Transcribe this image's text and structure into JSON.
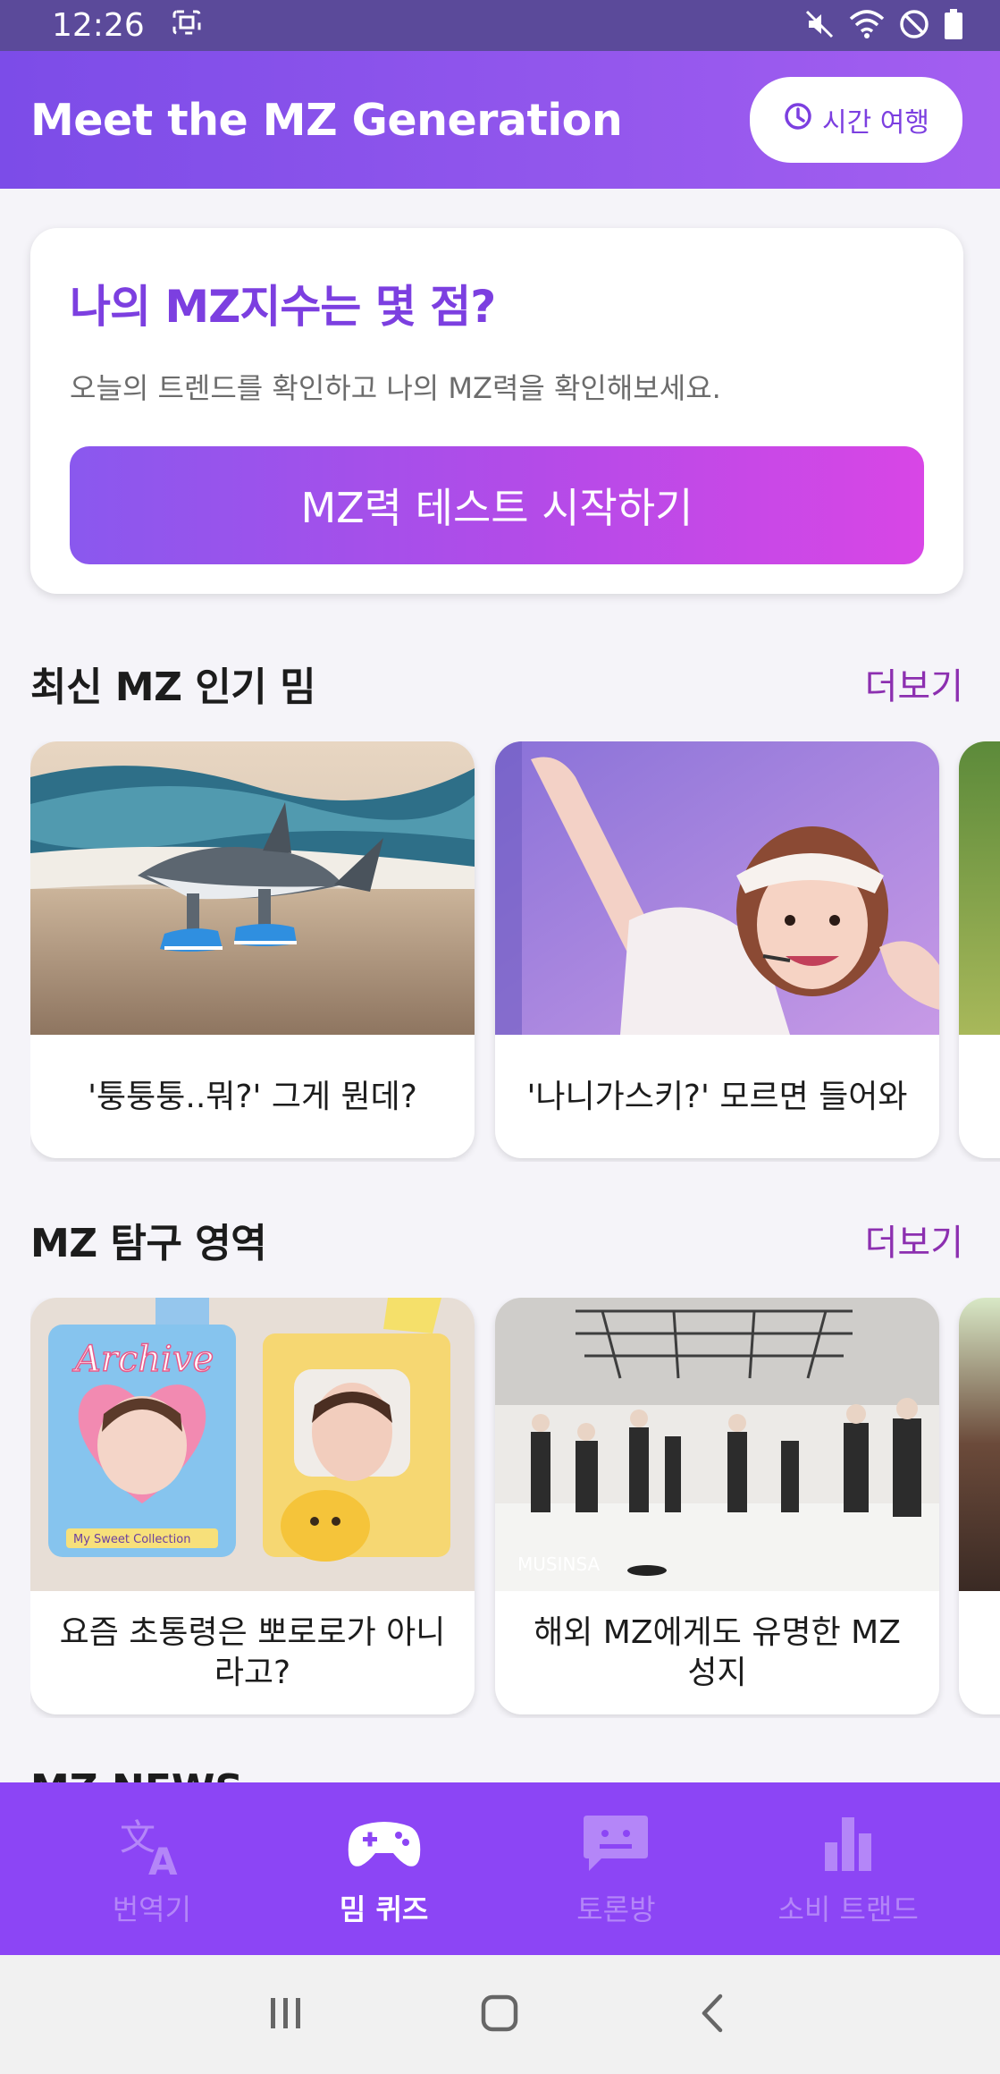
{
  "status_bar": {
    "time": "12:26"
  },
  "app_bar": {
    "title": "Meet the MZ Generation",
    "time_travel_label": "시간 여행"
  },
  "hero": {
    "title": "나의 MZ지수는 몇 점?",
    "subtitle": "오늘의 트렌드를 확인하고 나의 MZ력을 확인해보세요.",
    "button_label": "MZ력 테스트 시작하기"
  },
  "memes": {
    "title": "최신 MZ 인기 밈",
    "more_label": "더보기",
    "cards": [
      {
        "caption": "'퉁퉁퉁..뭐?' 그게 뭔데?"
      },
      {
        "caption": "'나니가스키?' 모르면 들어와"
      }
    ]
  },
  "explore": {
    "title": "MZ 탐구 영역",
    "more_label": "더보기",
    "cards": [
      {
        "caption": "요즘 초통령은 뽀로로가 아니라고?",
        "logo_text": "Archive",
        "tag_text": "My Sweet Collection"
      },
      {
        "caption": "해외 MZ에게도 유명한 MZ 성지",
        "watermark": "MUSINSA"
      }
    ]
  },
  "news_peek": {
    "title": "MZ NEWS"
  },
  "bottom_nav": {
    "items": [
      {
        "label": "번역기",
        "icon": "translate-icon",
        "active": false
      },
      {
        "label": "밈 퀴즈",
        "icon": "gamepad-icon",
        "active": true
      },
      {
        "label": "토론방",
        "icon": "chat-icon",
        "active": false
      },
      {
        "label": "소비 트랜드",
        "icon": "bar-chart-icon",
        "active": false
      }
    ]
  },
  "colors": {
    "accent": "#7c3fe0",
    "nav": "#8c45f5",
    "more": "#8c2fb0"
  }
}
